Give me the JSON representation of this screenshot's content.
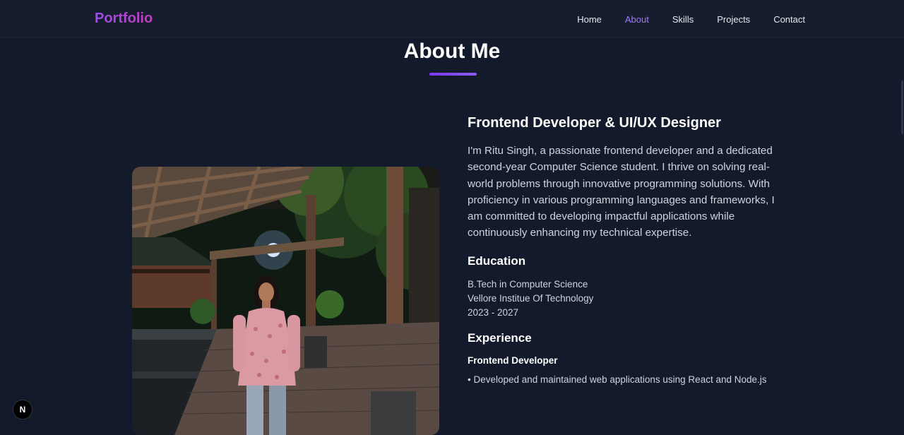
{
  "header": {
    "logo": "Portfolio",
    "nav": [
      {
        "label": "Home",
        "active": false
      },
      {
        "label": "About",
        "active": true
      },
      {
        "label": "Skills",
        "active": false
      },
      {
        "label": "Projects",
        "active": false
      },
      {
        "label": "Contact",
        "active": false
      }
    ]
  },
  "about": {
    "title": "About Me",
    "role": "Frontend Developer & UI/UX Designer",
    "bio": "I'm Ritu Singh, a passionate frontend developer and a dedicated second-year Computer Science student. I thrive on solving real-world problems through innovative programming solutions. With proficiency in various programming languages and frameworks, I am committed to developing impactful applications while continuously enhancing my technical expertise.",
    "education": {
      "heading": "Education",
      "degree": "B.Tech in Computer Science",
      "school": "Vellore Institue Of Technology",
      "years": "2023 - 2027"
    },
    "experience": {
      "heading": "Experience",
      "job": "Frontend Developer",
      "bullet": "• Developed and maintained web applications using React and Node.js"
    }
  },
  "badge": {
    "label": "N"
  },
  "colors": {
    "background": "#121a2c",
    "accent": "#a27bf1",
    "logo_gradient_start": "#9b4dea",
    "logo_gradient_end": "#c63db8"
  }
}
